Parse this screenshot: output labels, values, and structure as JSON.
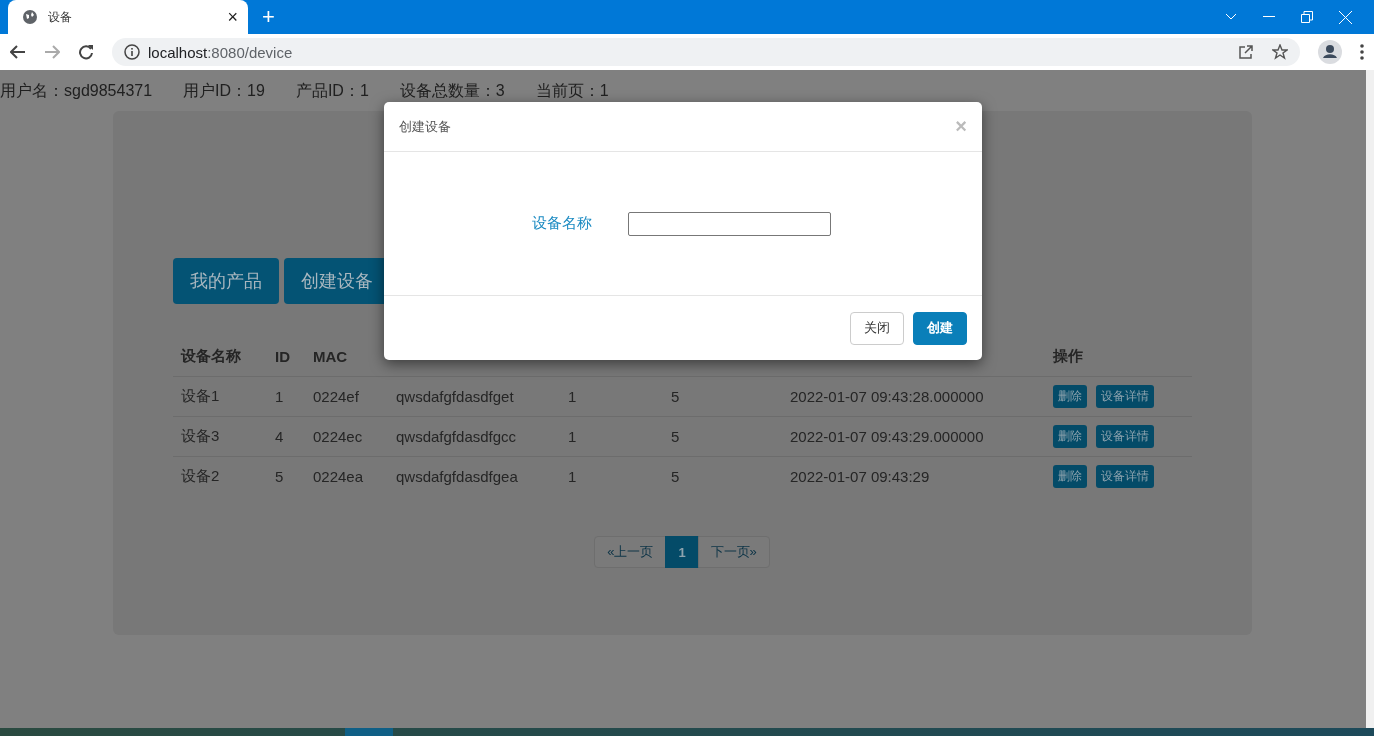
{
  "browser": {
    "tab_title": "设备",
    "tab_close": "×",
    "new_tab": "+",
    "address_host": "localhost",
    "address_rest": ":8080/device"
  },
  "info_bar": [
    "用户名：sgd9854371",
    "用户ID：19",
    "产品ID：1",
    "设备总数量：3",
    "当前页：1"
  ],
  "actions": [
    "我的产品",
    "创建设备"
  ],
  "table": {
    "columns": [
      "设备名称",
      "ID",
      "MAC",
      null,
      null,
      null,
      null,
      "操作"
    ],
    "rows": [
      {
        "cells": [
          "设备1",
          "1",
          "0224ef",
          "qwsdafgfdasdfget",
          "1",
          "5",
          "2022-01-07 09:43:28.000000"
        ],
        "actions": [
          "删除",
          "设备详情"
        ]
      },
      {
        "cells": [
          "设备3",
          "4",
          "0224ec",
          "qwsdafgfdasdfgcc",
          "1",
          "5",
          "2022-01-07 09:43:29.000000"
        ],
        "actions": [
          "删除",
          "设备详情"
        ]
      },
      {
        "cells": [
          "设备2",
          "5",
          "0224ea",
          "qwsdafgfdasdfgea",
          "1",
          "5",
          "2022-01-07 09:43:29"
        ],
        "actions": [
          "删除",
          "设备详情"
        ]
      }
    ]
  },
  "pagination": [
    {
      "label": "«上一页",
      "selected": false
    },
    {
      "label": "1",
      "selected": true
    },
    {
      "label": "下一页»",
      "selected": false
    }
  ],
  "modal": {
    "title": "创建设备",
    "close": "×",
    "field_label": "设备名称",
    "buttons": [
      {
        "label": "关闭",
        "kind": "default"
      },
      {
        "label": "创建",
        "kind": "primary"
      }
    ]
  }
}
